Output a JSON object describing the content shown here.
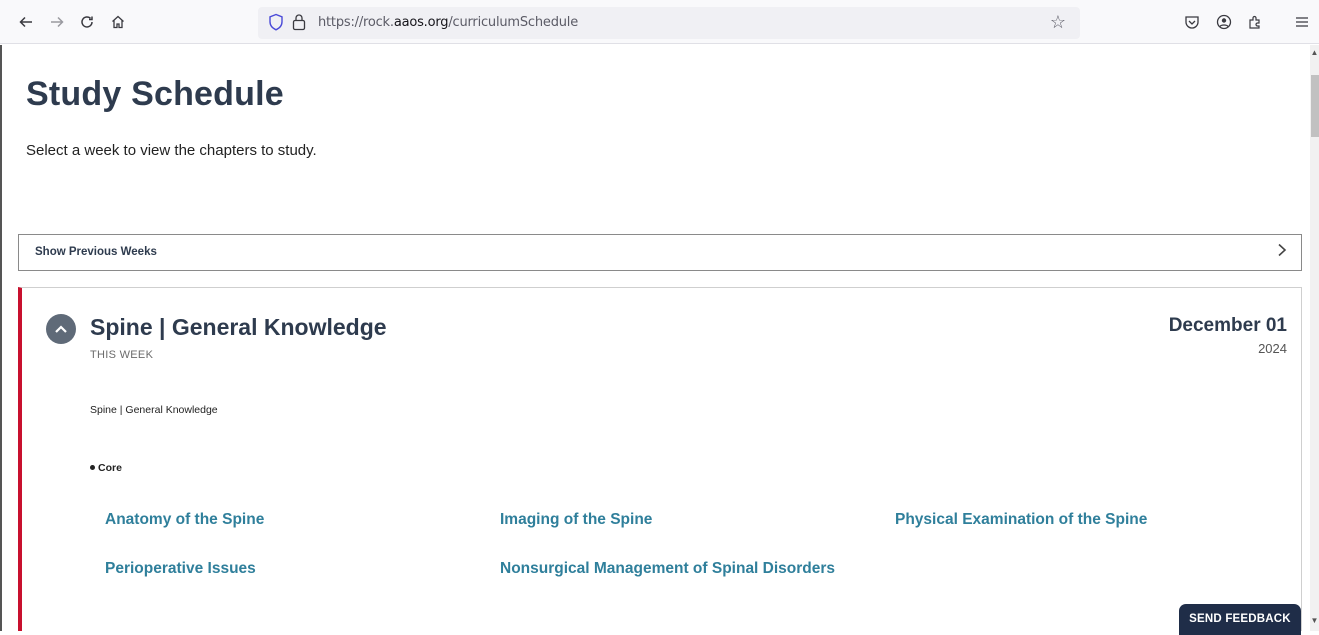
{
  "browser": {
    "url_prefix": "https://rock.",
    "url_domain": "aaos.org",
    "url_path": "/curriculumSchedule"
  },
  "page": {
    "title": "Study Schedule",
    "subtitle": "Select a week to view the chapters to study.",
    "show_previous_label": "Show Previous Weeks"
  },
  "week": {
    "title": "Spine | General Knowledge",
    "tag": "THIS WEEK",
    "date": "December 01",
    "year": "2024",
    "description": "Spine | General Knowledge",
    "section": "Core",
    "chapters": [
      "Anatomy of the Spine",
      "Imaging of the Spine",
      "Physical Examination of the Spine",
      "Perioperative Issues",
      "Nonsurgical Management of Spinal Disorders"
    ]
  },
  "feedback": {
    "label": "SEND FEEDBACK"
  }
}
